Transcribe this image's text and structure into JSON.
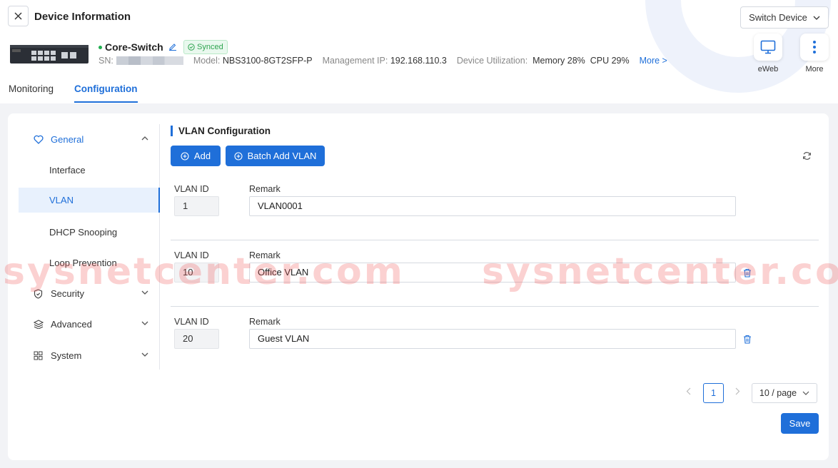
{
  "header": {
    "title": "Device Information",
    "switch_device_label": "Switch Device"
  },
  "device": {
    "name": "Core-Switch",
    "status_badge": "Synced",
    "sn_label": "SN:",
    "model_label": "Model:",
    "model": "NBS3100-8GT2SFP-P",
    "mgmt_ip_label": "Management IP:",
    "mgmt_ip": "192.168.110.3",
    "utilization_label": "Device Utilization:",
    "memory": "Memory 28%",
    "cpu": "CPU 29%",
    "more_link": "More >"
  },
  "actions": [
    {
      "label": "eWeb",
      "icon": "monitor-icon"
    },
    {
      "label": "More",
      "icon": "more-vertical-icon"
    }
  ],
  "tabs": [
    {
      "label": "Monitoring",
      "active": false
    },
    {
      "label": "Configuration",
      "active": true
    }
  ],
  "sidebar": {
    "general": {
      "label": "General",
      "icon": "heart-icon",
      "expanded": true
    },
    "sub_items": [
      {
        "label": "Interface",
        "active": false
      },
      {
        "label": "VLAN",
        "active": true
      },
      {
        "label": "DHCP Snooping",
        "active": false
      },
      {
        "label": "Loop Prevention",
        "active": false
      }
    ],
    "groups": [
      {
        "label": "Security",
        "icon": "shield-icon"
      },
      {
        "label": "Advanced",
        "icon": "layers-icon"
      },
      {
        "label": "System",
        "icon": "grid-icon"
      }
    ]
  },
  "vlan_config": {
    "title": "VLAN Configuration",
    "add_label": "Add",
    "batch_add_label": "Batch Add VLAN",
    "id_label": "VLAN ID",
    "remark_label": "Remark",
    "rows": [
      {
        "id": "1",
        "remark": "VLAN0001"
      },
      {
        "id": "10",
        "remark": "Office VLAN"
      },
      {
        "id": "20",
        "remark": "Guest VLAN"
      }
    ]
  },
  "pagination": {
    "current_page": "1",
    "page_size": "10 / page"
  },
  "save_label": "Save",
  "watermark": {
    "text_left": "sysnetcenter.com",
    "text_right": "sysnetcenter.co"
  },
  "colors": {
    "accent": "#1f6fd9",
    "success": "#2ea44f",
    "page_bg": "#f2f3f6"
  }
}
